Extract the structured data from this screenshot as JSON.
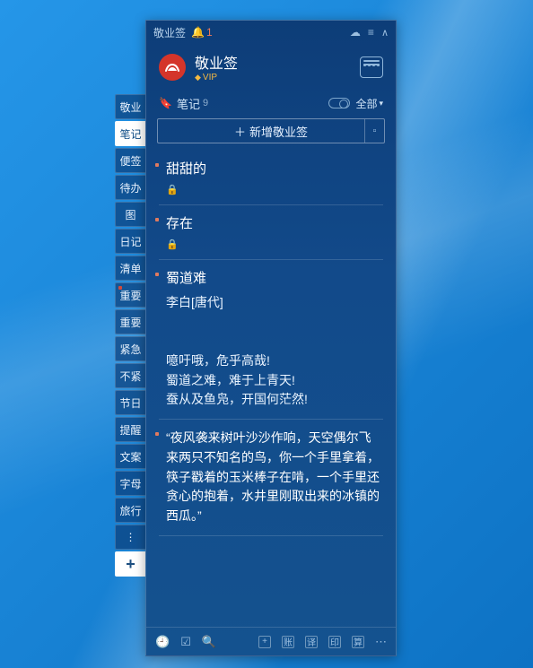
{
  "titlebar": {
    "title": "敬业签",
    "notification_count": "1"
  },
  "header": {
    "app_name": "敬业签",
    "vip_label": "VIP"
  },
  "section": {
    "label": "笔记",
    "count": "9",
    "filter_label": "全部"
  },
  "add_button_label": "新增敬业签",
  "sidebar": {
    "items": [
      {
        "label": "敬业",
        "active": false,
        "dot": false
      },
      {
        "label": "笔记",
        "active": true,
        "dot": false
      },
      {
        "label": "便签",
        "active": false,
        "dot": false
      },
      {
        "label": "待办",
        "active": false,
        "dot": false
      },
      {
        "label": "图",
        "active": false,
        "dot": false
      },
      {
        "label": "日记",
        "active": false,
        "dot": false
      },
      {
        "label": "清单",
        "active": false,
        "dot": false
      },
      {
        "label": "重要",
        "active": false,
        "dot": true
      },
      {
        "label": "重要",
        "active": false,
        "dot": false
      },
      {
        "label": "紧急",
        "active": false,
        "dot": false
      },
      {
        "label": "不紧",
        "active": false,
        "dot": false
      },
      {
        "label": "节日",
        "active": false,
        "dot": false
      },
      {
        "label": "提醒",
        "active": false,
        "dot": false
      },
      {
        "label": "文案",
        "active": false,
        "dot": false
      },
      {
        "label": "字母",
        "active": false,
        "dot": false
      },
      {
        "label": "旅行",
        "active": false,
        "dot": false
      }
    ],
    "more_label": "⋮",
    "add_label": "+"
  },
  "notes": [
    {
      "title": "甜甜的",
      "locked": true
    },
    {
      "title": "存在",
      "locked": true
    },
    {
      "title": "蜀道难",
      "body": "李白[唐代]\n\n\n噫吁哦，危乎高哉!\n蜀道之难，难于上青天!\n蚕从及鱼凫，开国何茫然!"
    },
    {
      "quote": "“夜风袭来树叶沙沙作响，天空偶尔飞来两只不知名的鸟，你一个手里拿着，筷子戳着的玉米棒子在啃，一个手里还贪心的抱着，水井里刚取出来的冰镇的西瓜。”"
    }
  ],
  "footer": {
    "labels": [
      "账",
      "译",
      "印",
      "算"
    ]
  }
}
